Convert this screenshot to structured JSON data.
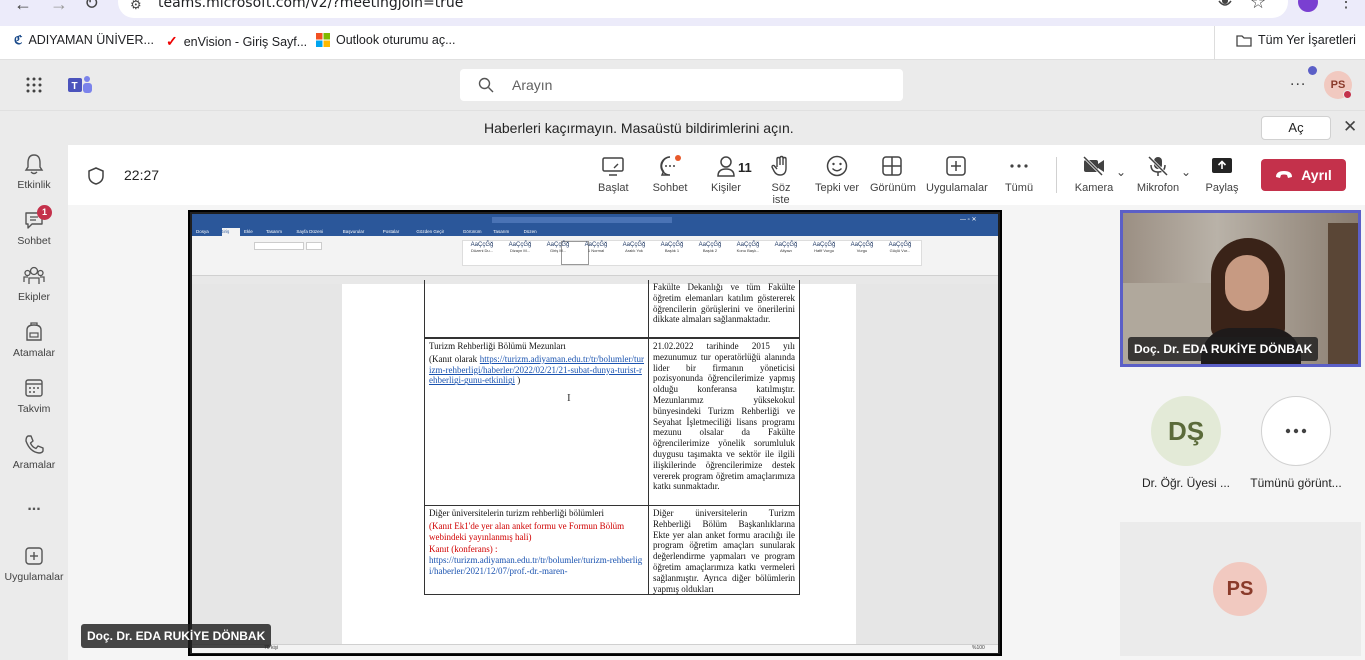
{
  "browser": {
    "url": "teams.microsoft.com/v2/?meetingjoin=true",
    "bookmarks": [
      {
        "label": "ADIYAMAN ÜNİVER...",
        "icon": "adiyaman-logo-icon"
      },
      {
        "label": "enVision - Giriş Sayf...",
        "icon": "envision-check-icon"
      },
      {
        "label": "Outlook oturumu aç...",
        "icon": "microsoft-logo-icon"
      }
    ],
    "all_bookmarks": "Tüm Yer İşaretleri"
  },
  "teams": {
    "search_placeholder": "Arayın",
    "user_initials": "PS",
    "more": "...",
    "notification": {
      "text": "Haberleri kaçırmayın. Masaüstü bildirimlerini açın.",
      "button": "Aç"
    }
  },
  "rail": [
    {
      "label": "Etkinlik",
      "icon": "bell-icon"
    },
    {
      "label": "Sohbet",
      "icon": "chat-icon",
      "badge": "1"
    },
    {
      "label": "Ekipler",
      "icon": "teams-icon"
    },
    {
      "label": "Atamalar",
      "icon": "backpack-icon"
    },
    {
      "label": "Takvim",
      "icon": "calendar-icon"
    },
    {
      "label": "Aramalar",
      "icon": "phone-icon"
    },
    {
      "label": "...",
      "icon": "more-icon"
    },
    {
      "label": "Uygulamalar",
      "icon": "add-apps-icon"
    }
  ],
  "meeting": {
    "timer": "22:27",
    "toolbar": {
      "share_screen": "Başlat",
      "chat": "Sohbet",
      "people": "Kişiler",
      "people_count": "11",
      "raise_hand": "Söz iste",
      "react": "Tepki ver",
      "view": "Görünüm",
      "apps": "Uygulamalar",
      "more": "Tümü",
      "camera": "Kamera",
      "mic": "Mikrofon",
      "share": "Paylaş",
      "leave": "Ayrıl"
    },
    "presenter_tag": "Doç. Dr. EDA RUKİYE DÖNBAK",
    "participants": [
      {
        "name": "Doç. Dr. EDA RUKİYE DÖNBAK"
      },
      {
        "initials": "DŞ",
        "name": "Dr. Öğr. Üyesi ..."
      },
      {
        "name": "Tümünü görünt..."
      },
      {
        "initials": "PS"
      }
    ]
  },
  "word": {
    "title": "Word",
    "tabs": [
      "Dosya",
      "Giriş",
      "Ekle",
      "Tasarım",
      "Sayfa Düzeni",
      "Başvurular",
      "Postalar",
      "Gözden Geçir",
      "Görünüm",
      "Tasarım",
      "Düzen"
    ],
    "styles": [
      "Düzeni Du...",
      "Dizayn M...",
      "Giriş M...",
      "1 Normal",
      "Aralık Yok",
      "Başlık 1",
      "Başlık 2",
      "Konu Başlı...",
      "Altyazı",
      "Hafif Vurgu",
      "Vurgu",
      "Güçlü Vur..."
    ],
    "status": "70 kişi",
    "zoom": "%100",
    "table": {
      "row1_right": "Fakülte Dekanlığı ve tüm Fakülte öğretim elemanları katılım göstererek öğrencilerin görüşlerini ve önerilerini dikkate almaları sağlanmaktadır.",
      "row2_left_title": "Turizm Rehberliği Bölümü Mezunları",
      "row2_left_kanit": "(Kanıt olarak",
      "row2_left_link": "https://turizm.adiyaman.edu.tr/tr/bolumler/turizm-rehberligi/haberler/2022/02/21/21-subat-dunya-turist-rehberligi-gunu-etkinligi",
      "row2_left_close": ")",
      "row2_right": "21.02.2022 tarihinde 2015 yılı mezunumuz tur operatörlüğü alanında lider bir firmanın yöneticisi pozisyonunda öğrencilerimize yapmış olduğu konferansa katılmıştır. Mezunlarımız yüksekokul bünyesindeki Turizm Rehberliği ve Seyahat İşletmeciliği lisans programı mezunu olsalar da Fakülte öğrencilerimize yönelik sorumluluk duygusu taşımakta ve sektör ile ilgili ilişkilerinde öğrencilerimize destek vererek program öğretim amaçlarımıza katkı sunmaktadır.",
      "row3_left_title": "Diğer üniversitelerin turizm rehberliği bölümleri",
      "row3_left_red1": "(Kanıt Ek1'de yer alan anket formu ve Formun Bölüm webindeki yayınlanmış hali)",
      "row3_left_red2": "Kanıt (konferans) :",
      "row3_left_link": "https://turizm.adiyaman.edu.tr/tr/bolumler/turizm-rehberligi/haberler/2021/12/07/prof.-dr.-maren-",
      "row3_right": "Diğer üniversitelerin Turizm Rehberliği Bölüm Başkanlıklarına Ekte yer alan anket formu aracılığı ile program öğretim amaçları sunularak değerlendirme yapmaları ve program öğretim amaçlarımıza katkı vermeleri sağlanmıştır. Ayrıca diğer bölümlerin yapmış oldukları"
    }
  }
}
